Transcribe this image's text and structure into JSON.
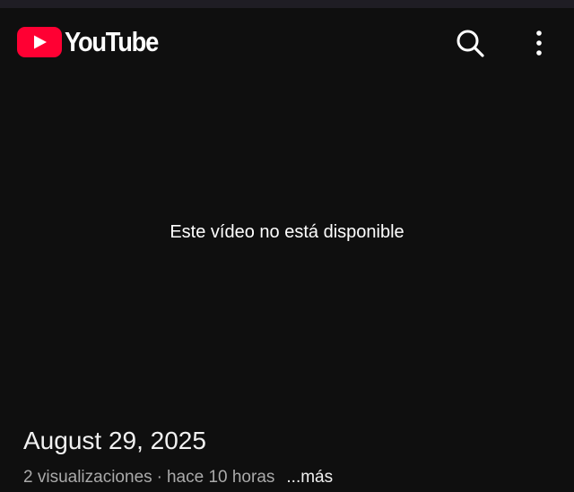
{
  "header": {
    "logo_text": "YouTube",
    "brand_color": "#ff0033",
    "search_icon": "search-icon",
    "menu_icon": "more-vertical-icon"
  },
  "player": {
    "message": "Este vídeo no está disponible"
  },
  "video": {
    "title": "August 29, 2025",
    "views": "2 visualizaciones",
    "separator": "·",
    "age": "hace 10 horas",
    "more_label": "...más"
  }
}
